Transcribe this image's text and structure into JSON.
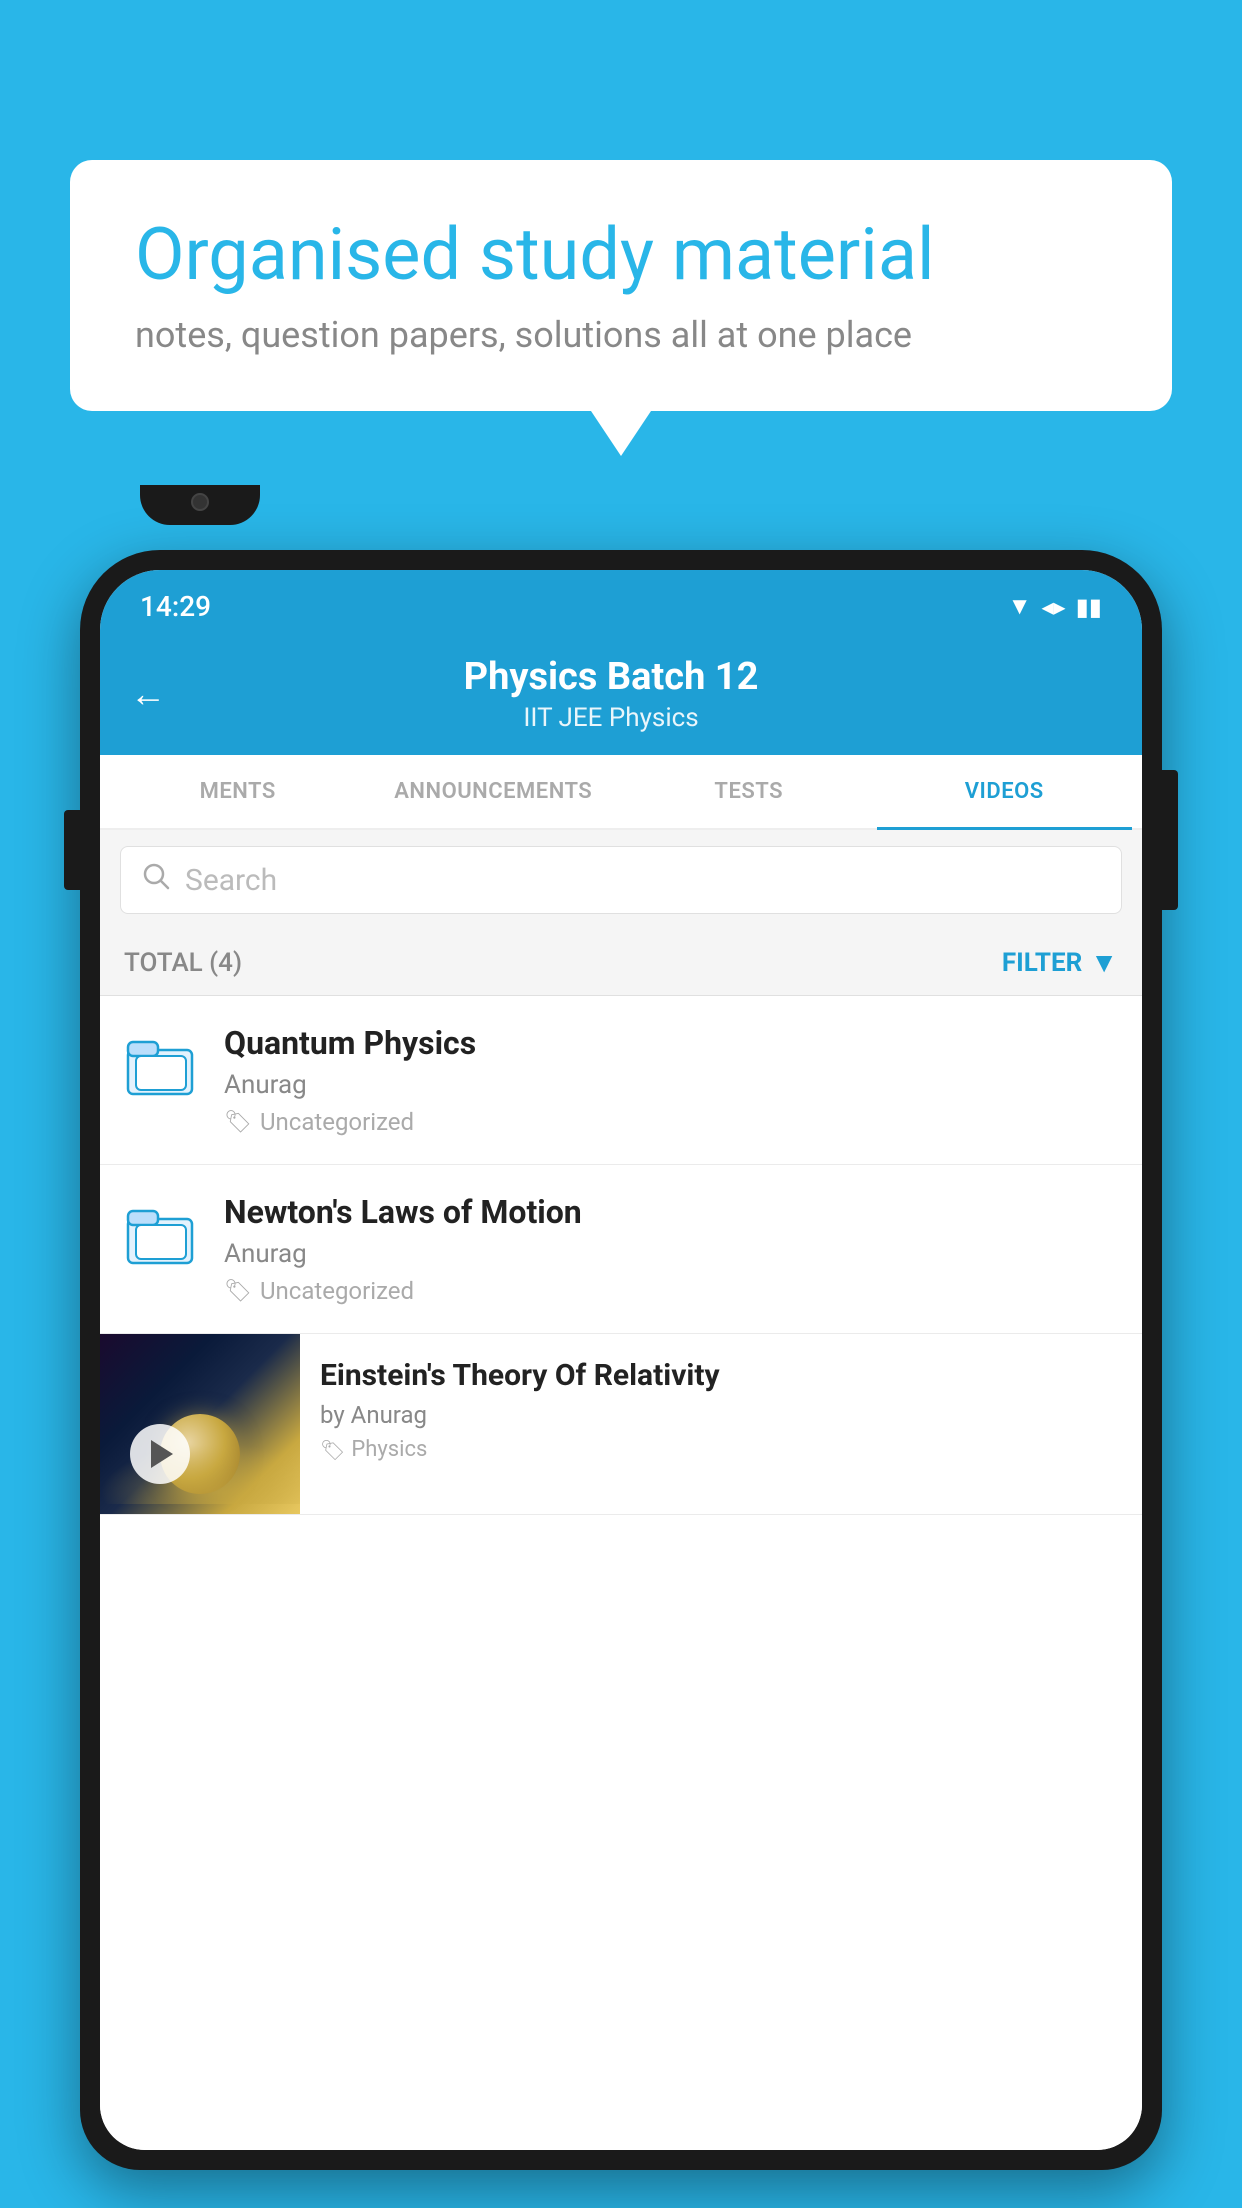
{
  "background_color": "#29b6e8",
  "speech_bubble": {
    "title": "Organised study material",
    "subtitle": "notes, question papers, solutions all at one place"
  },
  "status_bar": {
    "time": "14:29",
    "wifi": "▼",
    "signal": "▲",
    "battery": "▮"
  },
  "app_bar": {
    "title": "Physics Batch 12",
    "subtitle": "IIT JEE   Physics",
    "back_label": "←"
  },
  "tabs": [
    {
      "label": "MENTS",
      "active": false
    },
    {
      "label": "ANNOUNCEMENTS",
      "active": false
    },
    {
      "label": "TESTS",
      "active": false
    },
    {
      "label": "VIDEOS",
      "active": true
    }
  ],
  "search": {
    "placeholder": "Search"
  },
  "filter_bar": {
    "total_label": "TOTAL (4)",
    "filter_label": "FILTER"
  },
  "list_items": [
    {
      "title": "Quantum Physics",
      "author": "Anurag",
      "tag": "Uncategorized",
      "has_thumbnail": false
    },
    {
      "title": "Newton's Laws of Motion",
      "author": "Anurag",
      "tag": "Uncategorized",
      "has_thumbnail": false
    },
    {
      "title": "Einstein's Theory Of Relativity",
      "author": "by Anurag",
      "tag": "Physics",
      "has_thumbnail": true
    }
  ]
}
